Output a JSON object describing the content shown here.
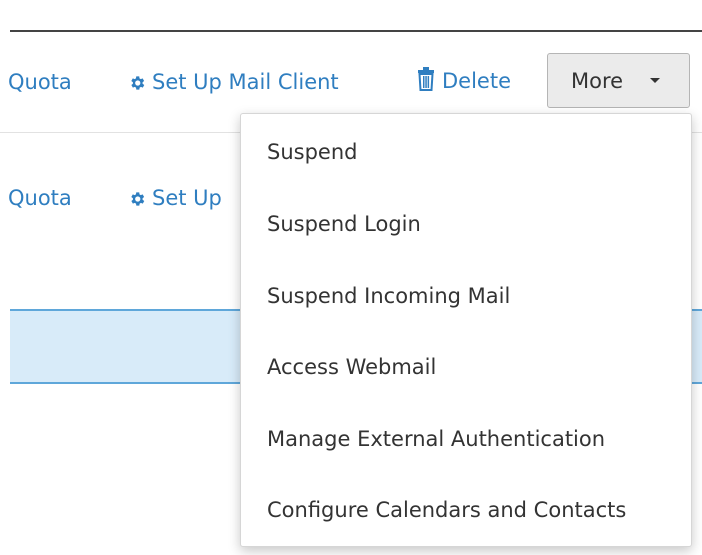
{
  "row1": {
    "quota_label": "Quota",
    "setup_mail_client_label": "Set Up Mail Client",
    "delete_label": "Delete",
    "more_label": "More"
  },
  "row2": {
    "quota_label": "Quota",
    "setup_label": "Set Up"
  },
  "dropdown": {
    "items": [
      "Suspend",
      "Suspend Login",
      "Suspend Incoming Mail",
      "Access Webmail",
      "Manage External Authentication",
      "Configure Calendars and Contacts"
    ]
  },
  "colors": {
    "link": "#2f7ec0",
    "highlight_row": "#d8ebf9",
    "highlight_border": "#5fa7da"
  },
  "icons": {
    "gear": "gear-icon",
    "trash": "trash-icon",
    "caret": "caret-down-icon"
  }
}
